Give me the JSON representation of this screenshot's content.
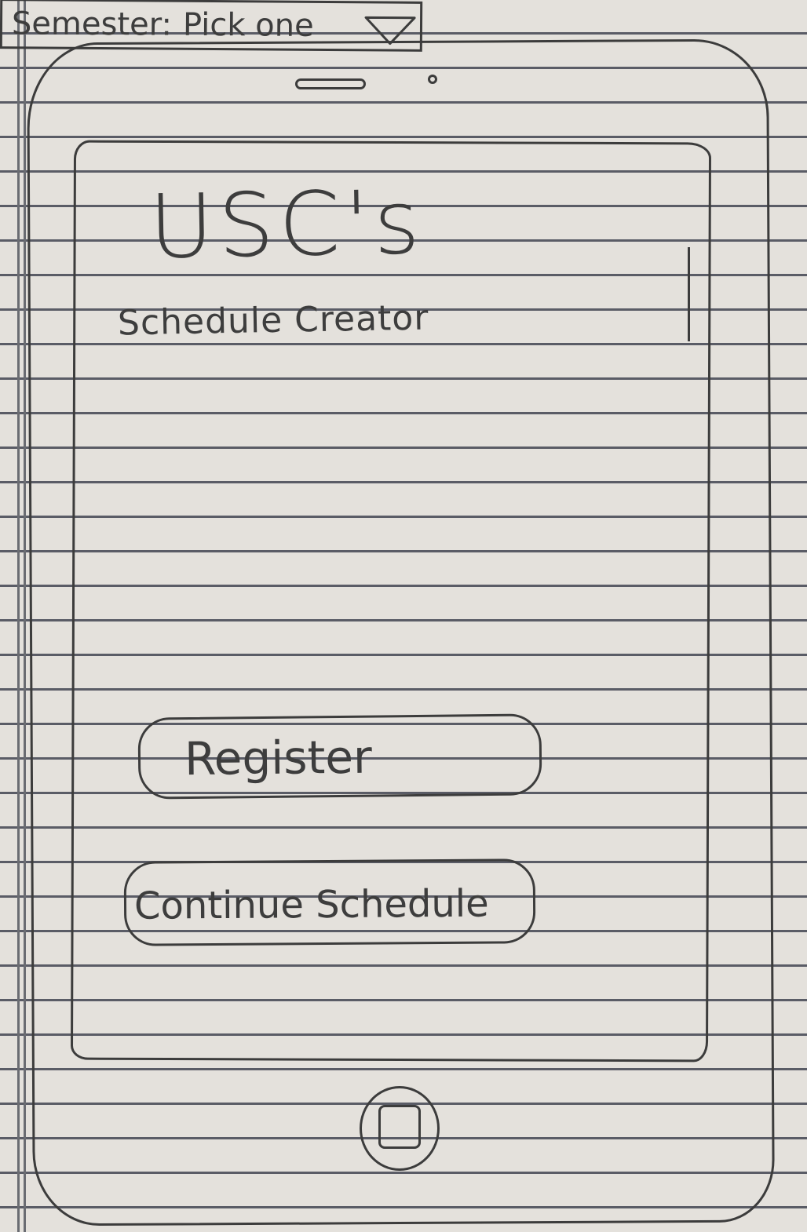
{
  "app": {
    "title": "USC's",
    "subtitle": "Schedule Creator"
  },
  "semester": {
    "label": "Semester:",
    "selected": "Pick one",
    "arrow_icon": "chevron-down-icon"
  },
  "actions": {
    "register_label": "Register",
    "continue_label": "Continue Schedule"
  },
  "device": {
    "home_icon": "home-button-icon"
  },
  "colors": {
    "paper": "#e4e1dc",
    "ruled_lines": "#5a5c66",
    "pencil": "#3c3c3c"
  }
}
